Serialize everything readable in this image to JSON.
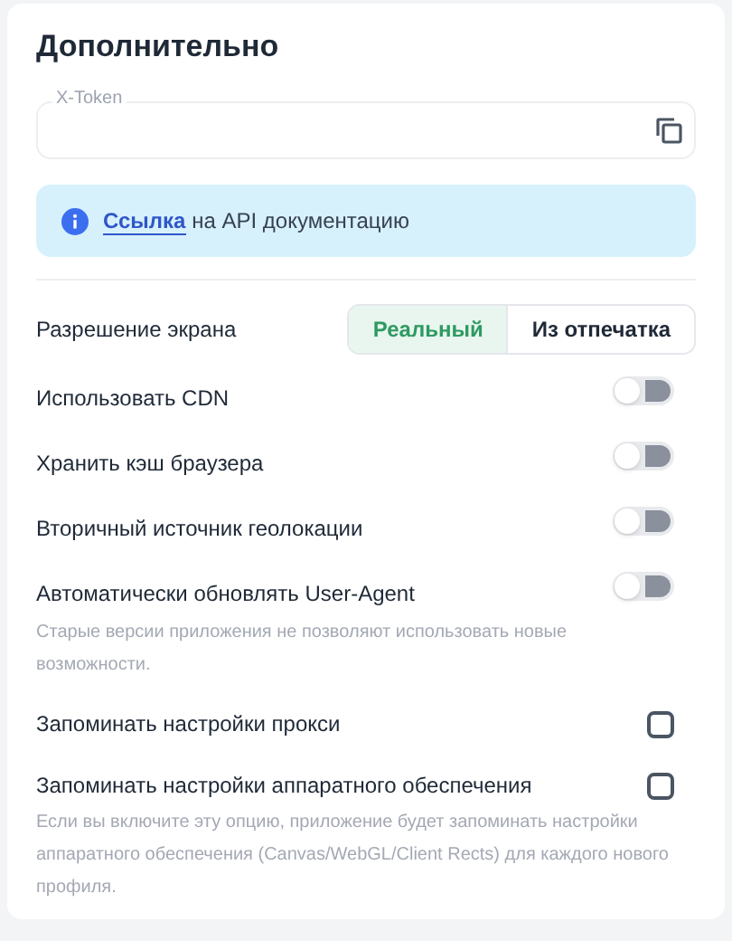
{
  "title": "Дополнительно",
  "token_field": {
    "label": "X-Token"
  },
  "info": {
    "link": "Ссылка",
    "text": "на API документацию"
  },
  "resolution": {
    "label": "Разрешение экрана",
    "options": [
      {
        "label": "Реальный",
        "selected": true
      },
      {
        "label": "Из отпечатка",
        "selected": false
      }
    ]
  },
  "settings": [
    {
      "kind": "toggle",
      "label": "Использовать CDN",
      "on": false
    },
    {
      "kind": "toggle",
      "label": "Хранить кэш браузера",
      "on": false
    },
    {
      "kind": "toggle",
      "label": "Вторичный источник геолокации",
      "on": false
    },
    {
      "kind": "toggle",
      "label": "Автоматически обновлять User-Agent",
      "on": false,
      "hint": "Старые версии приложения не позволяют использовать новые возможности."
    },
    {
      "kind": "checkbox",
      "label": "Запоминать настройки прокси",
      "checked": false
    },
    {
      "kind": "checkbox",
      "label": "Запоминать настройки аппаратного обеспечения",
      "checked": false,
      "hint": "Если вы включите эту опцию, приложение будет запоминать настройки аппаратного обеспечения (Canvas/WebGL/Client Rects) для каждого нового профиля."
    }
  ]
}
